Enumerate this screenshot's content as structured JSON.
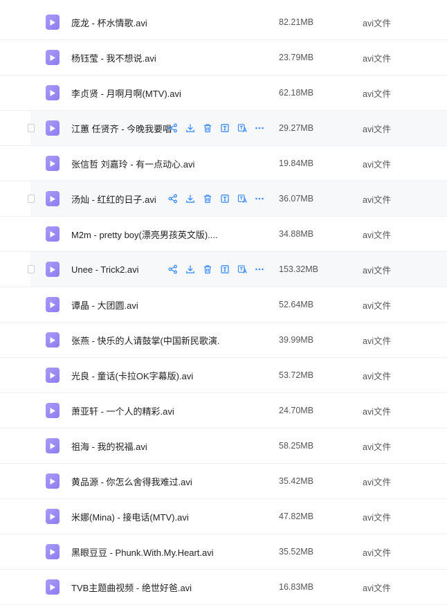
{
  "files": [
    {
      "name": "庞龙 - 杯水情歌.avi",
      "size": "82.21MB",
      "type": "avi文件",
      "hover": false
    },
    {
      "name": "杨钰莹 - 我不想说.avi",
      "size": "23.79MB",
      "type": "avi文件",
      "hover": false
    },
    {
      "name": "李贞贤 - 月啊月啊(MTV).avi",
      "size": "62.18MB",
      "type": "avi文件",
      "hover": false
    },
    {
      "name": "江蕙 任贤齐 - 今晚我要唱",
      "size": "29.27MB",
      "type": "avi文件",
      "hover": true
    },
    {
      "name": "张信哲 刘嘉玲 - 有一点动心.avi",
      "size": "19.84MB",
      "type": "avi文件",
      "hover": false
    },
    {
      "name": "汤灿 - 红红的日子.avi",
      "size": "36.07MB",
      "type": "avi文件",
      "hover": true
    },
    {
      "name": "M2m - pretty boy(漂亮男孩英文版)....",
      "size": "34.88MB",
      "type": "avi文件",
      "hover": false
    },
    {
      "name": "Unee - Trick2.avi",
      "size": "153.32MB",
      "type": "avi文件",
      "hover": true
    },
    {
      "name": "谭晶 - 大团圆.avi",
      "size": "52.64MB",
      "type": "avi文件",
      "hover": false
    },
    {
      "name": "张燕 - 快乐的人请鼓掌(中国新民歌演...",
      "size": "39.99MB",
      "type": "avi文件",
      "hover": false
    },
    {
      "name": "光良 - 童话(卡拉OK字幕版).avi",
      "size": "53.72MB",
      "type": "avi文件",
      "hover": false
    },
    {
      "name": "萧亚轩 - 一个人的精彩.avi",
      "size": "24.70MB",
      "type": "avi文件",
      "hover": false
    },
    {
      "name": "祖海 - 我的祝福.avi",
      "size": "58.25MB",
      "type": "avi文件",
      "hover": false
    },
    {
      "name": "黄品源 - 你怎么舍得我难过.avi",
      "size": "35.42MB",
      "type": "avi文件",
      "hover": false
    },
    {
      "name": "米娜(Mina) - 接电话(MTV).avi",
      "size": "47.82MB",
      "type": "avi文件",
      "hover": false
    },
    {
      "name": "黑眼豆豆 - Phunk.With.My.Heart.avi",
      "size": "35.52MB",
      "type": "avi文件",
      "hover": false
    },
    {
      "name": "TVB主题曲视频 - 绝世好爸.avi",
      "size": "16.83MB",
      "type": "avi文件",
      "hover": false
    }
  ],
  "action_icons": [
    "share-icon",
    "download-icon",
    "delete-icon",
    "text-extract-icon",
    "translate-icon",
    "more-icon"
  ],
  "colors": {
    "accent": "#3b8cff",
    "file_icon": "#8d7cf2",
    "hover_bg": "#f7f8fa"
  }
}
